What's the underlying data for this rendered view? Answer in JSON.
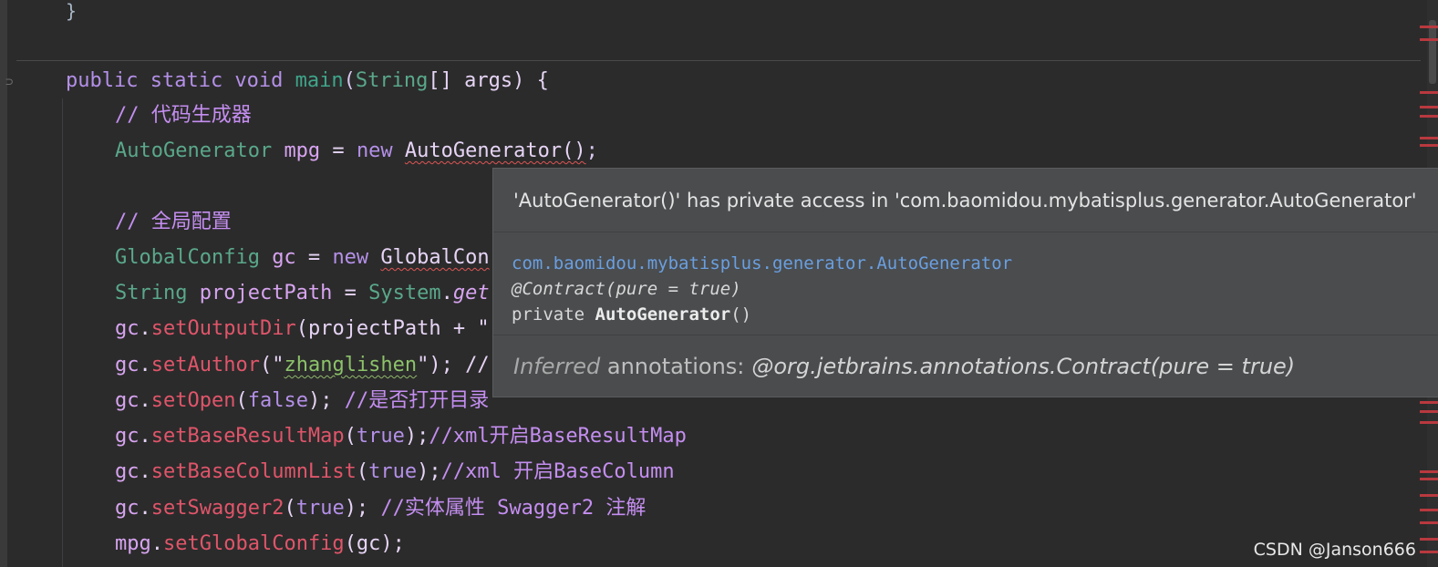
{
  "editor": {
    "top_brace": "}",
    "lines": [
      {
        "parts": [
          [
            "public static void ",
            "c-kw"
          ],
          [
            "main",
            "c-main"
          ],
          [
            "(",
            "c-punc"
          ],
          [
            "String",
            "c-type"
          ],
          [
            "[] args) {",
            "c-txt"
          ]
        ]
      },
      {
        "parts": [
          [
            "// 代码生成器",
            "c-cmt"
          ]
        ]
      },
      {
        "parts": [
          [
            "AutoGenerator ",
            "c-type"
          ],
          [
            "mpg",
            "c-var"
          ],
          [
            " = ",
            "c-txt"
          ],
          [
            "new ",
            "c-kw"
          ],
          [
            "AutoGenerator()",
            "c-txt err"
          ],
          [
            ";",
            "c-punc"
          ]
        ]
      },
      {
        "parts": [
          [
            "",
            "c-txt"
          ]
        ]
      },
      {
        "parts": [
          [
            "// 全局配置",
            "c-cmt"
          ]
        ]
      },
      {
        "parts": [
          [
            "GlobalConfig ",
            "c-type"
          ],
          [
            "gc",
            "c-var"
          ],
          [
            " = ",
            "c-txt"
          ],
          [
            "new ",
            "c-kw"
          ],
          [
            "GlobalCon",
            "c-txt err"
          ]
        ]
      },
      {
        "parts": [
          [
            "String ",
            "c-type"
          ],
          [
            "projectPath",
            "c-var"
          ],
          [
            " = ",
            "c-txt"
          ],
          [
            "System",
            "c-type"
          ],
          [
            ".",
            "c-txt"
          ],
          [
            "get",
            "c-var italic"
          ]
        ]
      },
      {
        "parts": [
          [
            "gc",
            "c-var"
          ],
          [
            ".",
            "c-txt"
          ],
          [
            "setOutputDir",
            "c-meth"
          ],
          [
            "(projectPath + \"",
            "c-txt"
          ]
        ]
      },
      {
        "parts": [
          [
            "gc",
            "c-var"
          ],
          [
            ".",
            "c-txt"
          ],
          [
            "setAuthor",
            "c-meth"
          ],
          [
            "(\"",
            "c-txt"
          ],
          [
            "zhanglishen",
            "c-str warn"
          ],
          [
            "\"); //",
            "c-txt"
          ]
        ]
      },
      {
        "parts": [
          [
            "gc",
            "c-var"
          ],
          [
            ".",
            "c-txt"
          ],
          [
            "setOpen",
            "c-meth"
          ],
          [
            "(",
            "c-txt"
          ],
          [
            "false",
            "c-bool"
          ],
          [
            "); ",
            "c-txt"
          ],
          [
            "//是否打开目录",
            "c-cmt"
          ]
        ]
      },
      {
        "parts": [
          [
            "gc",
            "c-var"
          ],
          [
            ".",
            "c-txt"
          ],
          [
            "setBaseResultMap",
            "c-meth"
          ],
          [
            "(",
            "c-txt"
          ],
          [
            "true",
            "c-bool"
          ],
          [
            ");",
            "c-txt"
          ],
          [
            "//xml开启BaseResultMap",
            "c-cmt"
          ]
        ]
      },
      {
        "parts": [
          [
            "gc",
            "c-var"
          ],
          [
            ".",
            "c-txt"
          ],
          [
            "setBaseColumnList",
            "c-meth"
          ],
          [
            "(",
            "c-txt"
          ],
          [
            "true",
            "c-bool"
          ],
          [
            ");",
            "c-txt"
          ],
          [
            "//xml 开启BaseColumn",
            "c-cmt"
          ]
        ]
      },
      {
        "parts": [
          [
            "gc",
            "c-var"
          ],
          [
            ".",
            "c-txt"
          ],
          [
            "setSwagger2",
            "c-meth"
          ],
          [
            "(",
            "c-txt"
          ],
          [
            "true",
            "c-bool"
          ],
          [
            "); ",
            "c-txt"
          ],
          [
            "//实体属性 Swagger2 注解",
            "c-cmt"
          ]
        ]
      },
      {
        "parts": [
          [
            "mpg",
            "c-var"
          ],
          [
            ".",
            "c-txt"
          ],
          [
            "setGlobalConfig",
            "c-meth"
          ],
          [
            "(gc);",
            "c-txt"
          ]
        ]
      }
    ]
  },
  "tooltip": {
    "message": "'AutoGenerator()' has private access in 'com.baomidou.mybatisplus.generator.AutoGenerator'",
    "fqn": "com.baomidou.mybatisplus.generator.AutoGenerator",
    "annotation": "@Contract(pure = true)",
    "signature_prefix": "private ",
    "signature_name": "AutoGenerator",
    "signature_suffix": "()",
    "footer_inferred": "Inferred",
    "footer_label": " annotations:",
    "footer_annotation": "@org.jetbrains.annotations.Contract(pure = true)"
  },
  "watermark": "CSDN @Janson666"
}
